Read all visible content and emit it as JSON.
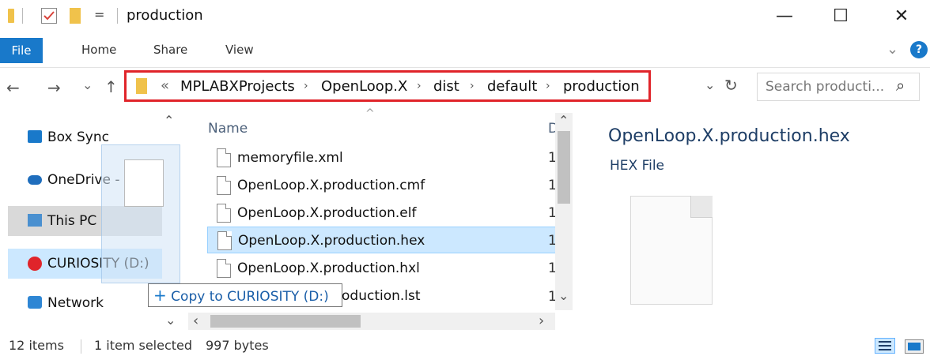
{
  "titlebar": {
    "title": "production",
    "minimize": "—",
    "maximize": "☐",
    "close": "✕",
    "qa_dropdown": "="
  },
  "ribbon": {
    "file": "File",
    "home": "Home",
    "share": "Share",
    "view": "View",
    "help": "?",
    "expand": "⌄"
  },
  "nav": {
    "back": "←",
    "forward": "→",
    "recent": "⌄",
    "up": "↑"
  },
  "address": {
    "prefix": "«",
    "crumbs": [
      "MPLABXProjects",
      "OpenLoop.X",
      "dist",
      "default",
      "production"
    ],
    "sep": "›",
    "dropdown": "⌄",
    "refresh": "↻"
  },
  "search": {
    "placeholder": "Search producti...",
    "icon": "⌕"
  },
  "sidebar": {
    "items": [
      {
        "label": "Box Sync",
        "icon": "box-sync-icon"
      },
      {
        "label": "OneDrive - Micr",
        "icon": "onedrive-icon"
      },
      {
        "label": "This PC",
        "icon": "this-pc-icon"
      },
      {
        "label": "CURIOSITY (D:)",
        "icon": "curiosity-drive-icon"
      },
      {
        "label": "Network",
        "icon": "network-icon"
      }
    ],
    "scroll_up": "⌃",
    "scroll_down": "⌄"
  },
  "filelist": {
    "col_name": "Name",
    "col_date": "D",
    "sort_indicator": "^",
    "scroll_up": "⌃",
    "scroll_down": "⌄",
    "scroll_left": "‹",
    "scroll_right": "›",
    "rows": [
      {
        "name": "memoryfile.xml",
        "col2": "1"
      },
      {
        "name": "OpenLoop.X.production.cmf",
        "col2": "1"
      },
      {
        "name": "OpenLoop.X.production.elf",
        "col2": "1"
      },
      {
        "name": "OpenLoop.X.production.hex",
        "col2": "1",
        "selected": true
      },
      {
        "name": "OpenLoop.X.production.hxl",
        "col2": "1"
      },
      {
        "name": "OpenLoop.X.production.lst",
        "col2": "1",
        "visible_text": "oduction.lst"
      }
    ]
  },
  "drag_tooltip": {
    "plus": "+",
    "text": "Copy to CURIOSITY (D:)"
  },
  "preview": {
    "filename": "OpenLoop.X.production.hex",
    "type": "HEX File"
  },
  "statusbar": {
    "items": "12 items",
    "selected": "1 item selected",
    "size": "997 bytes"
  },
  "colors": {
    "accent": "#1979ca",
    "selection": "#cce8ff",
    "highlight_box": "#e0242a"
  }
}
